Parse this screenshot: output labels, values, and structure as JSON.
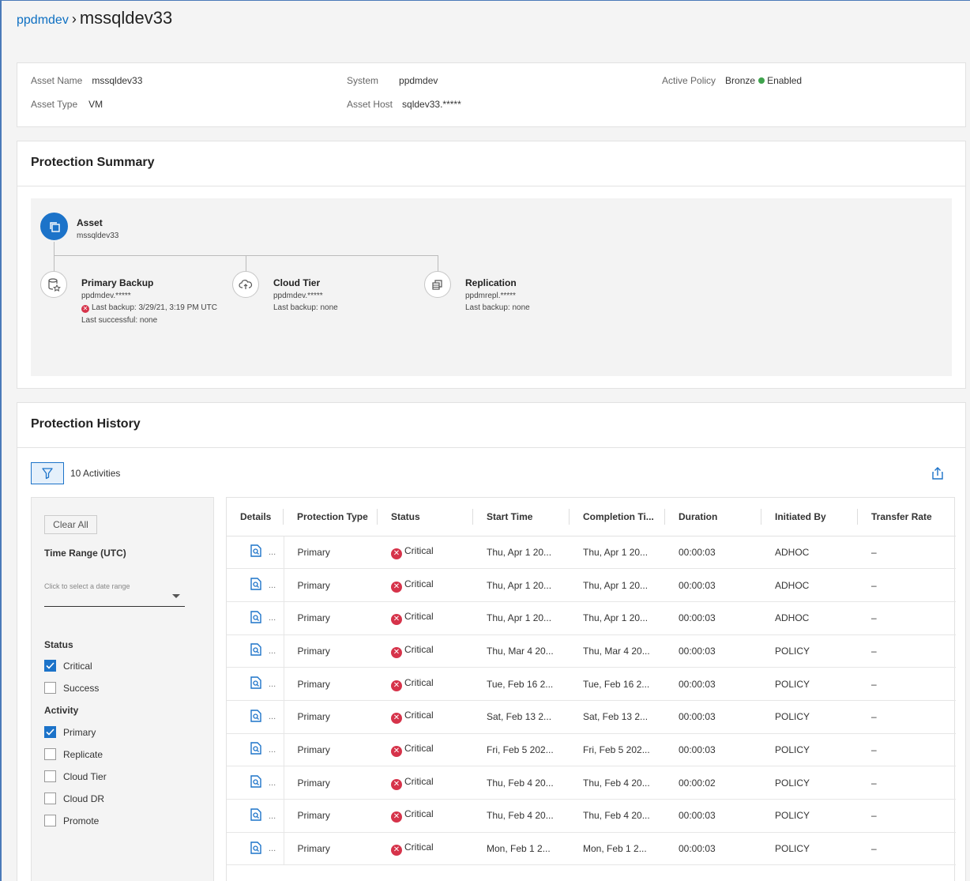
{
  "breadcrumb": {
    "parent": "ppdmdev",
    "separator": "›",
    "current": "mssqldev33"
  },
  "asset_info": {
    "asset_name_label": "Asset Name",
    "asset_name": "mssqldev33",
    "asset_type_label": "Asset Type",
    "asset_type": "VM",
    "system_label": "System",
    "system": "ppdmdev",
    "asset_host_label": "Asset Host",
    "asset_host": "sqldev33.*****",
    "active_policy_label": "Active Policy",
    "active_policy": "Bronze",
    "policy_status": "Enabled"
  },
  "protection_summary": {
    "title": "Protection Summary",
    "asset": {
      "title": "Asset",
      "name": "mssqldev33"
    },
    "primary_backup": {
      "title": "Primary Backup",
      "target": "ppdmdev.*****",
      "last_backup": "Last backup: 3/29/21, 3:19 PM UTC",
      "last_successful": "Last successful: none"
    },
    "cloud_tier": {
      "title": "Cloud Tier",
      "target": "ppdmdev.*****",
      "last_backup": "Last backup: none"
    },
    "replication": {
      "title": "Replication",
      "target": "ppdmrepl.*****",
      "last_backup": "Last backup: none"
    }
  },
  "protection_history": {
    "title": "Protection History",
    "activity_count": "10 Activities",
    "filters": {
      "clear_all": "Clear All",
      "time_range_label": "Time Range (UTC)",
      "date_placeholder": "Click to select a date range",
      "status_label": "Status",
      "status_options": [
        {
          "label": "Critical",
          "checked": true
        },
        {
          "label": "Success",
          "checked": false
        }
      ],
      "activity_label": "Activity",
      "activity_options": [
        {
          "label": "Primary",
          "checked": true
        },
        {
          "label": "Replicate",
          "checked": false
        },
        {
          "label": "Cloud Tier",
          "checked": false
        },
        {
          "label": "Cloud DR",
          "checked": false
        },
        {
          "label": "Promote",
          "checked": false
        }
      ]
    },
    "columns": [
      "Details",
      "Protection Type",
      "Status",
      "Start Time",
      "Completion Ti...",
      "Duration",
      "Initiated By",
      "Transfer Rate"
    ],
    "rows": [
      {
        "details": "...",
        "type": "Primary",
        "status": "Critical",
        "start": "Thu, Apr 1 20...",
        "completion": "Thu, Apr 1 20...",
        "duration": "00:00:03",
        "initiated": "ADHOC",
        "rate": "–"
      },
      {
        "details": "...",
        "type": "Primary",
        "status": "Critical",
        "start": "Thu, Apr 1 20...",
        "completion": "Thu, Apr 1 20...",
        "duration": "00:00:03",
        "initiated": "ADHOC",
        "rate": "–"
      },
      {
        "details": "...",
        "type": "Primary",
        "status": "Critical",
        "start": "Thu, Apr 1 20...",
        "completion": "Thu, Apr 1 20...",
        "duration": "00:00:03",
        "initiated": "ADHOC",
        "rate": "–"
      },
      {
        "details": "...",
        "type": "Primary",
        "status": "Critical",
        "start": "Thu, Mar 4 20...",
        "completion": "Thu, Mar 4 20...",
        "duration": "00:00:03",
        "initiated": "POLICY",
        "rate": "–"
      },
      {
        "details": "...",
        "type": "Primary",
        "status": "Critical",
        "start": "Tue, Feb 16 2...",
        "completion": "Tue, Feb 16 2...",
        "duration": "00:00:03",
        "initiated": "POLICY",
        "rate": "–"
      },
      {
        "details": "...",
        "type": "Primary",
        "status": "Critical",
        "start": "Sat, Feb 13 2...",
        "completion": "Sat, Feb 13 2...",
        "duration": "00:00:03",
        "initiated": "POLICY",
        "rate": "–"
      },
      {
        "details": "...",
        "type": "Primary",
        "status": "Critical",
        "start": "Fri, Feb 5 202...",
        "completion": "Fri, Feb 5 202...",
        "duration": "00:00:03",
        "initiated": "POLICY",
        "rate": "–"
      },
      {
        "details": "...",
        "type": "Primary",
        "status": "Critical",
        "start": "Thu, Feb 4 20...",
        "completion": "Thu, Feb 4 20...",
        "duration": "00:00:02",
        "initiated": "POLICY",
        "rate": "–"
      },
      {
        "details": "...",
        "type": "Primary",
        "status": "Critical",
        "start": "Thu, Feb 4 20...",
        "completion": "Thu, Feb 4 20...",
        "duration": "00:00:03",
        "initiated": "POLICY",
        "rate": "–"
      },
      {
        "details": "...",
        "type": "Primary",
        "status": "Critical",
        "start": "Mon, Feb 1 2...",
        "completion": "Mon, Feb 1 2...",
        "duration": "00:00:03",
        "initiated": "POLICY",
        "rate": "–"
      }
    ]
  },
  "colors": {
    "accent": "#1c73c9",
    "critical": "#d6334a",
    "enabled": "#3fa34d"
  }
}
